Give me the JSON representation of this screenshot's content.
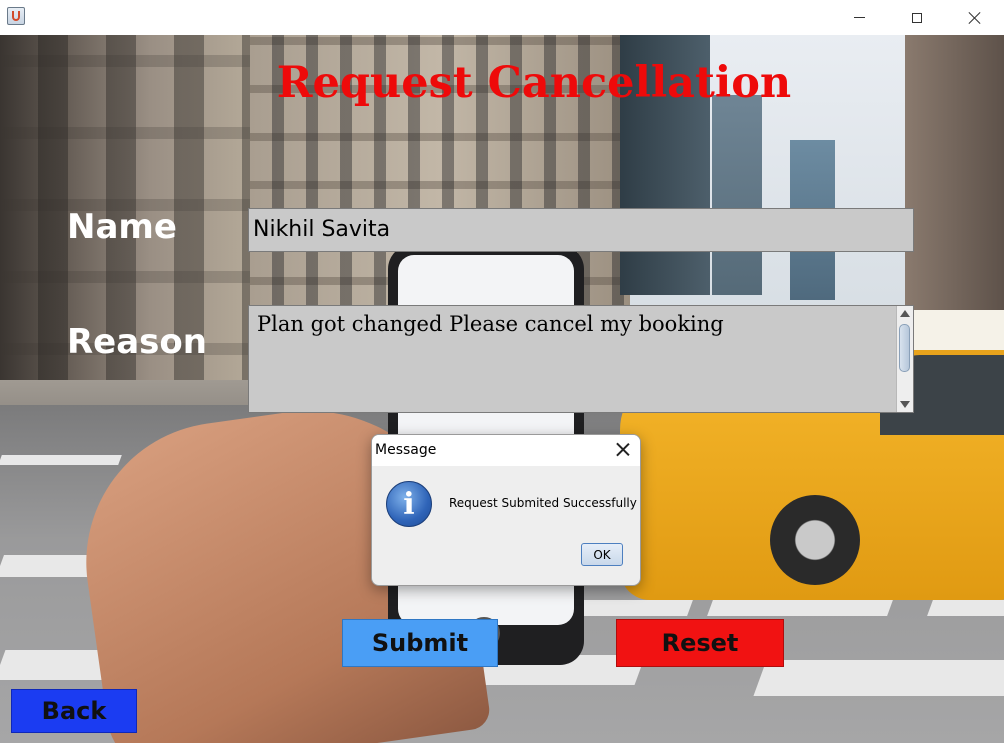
{
  "window": {
    "controls": {
      "minimize_icon": "minimize-icon",
      "maximize_icon": "maximize-icon",
      "close_icon": "close-icon"
    }
  },
  "form": {
    "title": "Request Cancellation",
    "name_label": "Name",
    "name_value": "Nikhil Savita",
    "reason_label": "Reason",
    "reason_value": "Plan got changed Please cancel my booking"
  },
  "buttons": {
    "submit": "Submit",
    "reset": "Reset",
    "back": "Back"
  },
  "dialog": {
    "title": "Message",
    "icon": "info-icon",
    "icon_glyph": "i",
    "message": "Request Submited Successfully",
    "ok": "OK"
  },
  "colors": {
    "title": "#ee0a0a",
    "submit": "#4a9ef5",
    "reset": "#f11212",
    "back": "#1b3cf2",
    "input_bg": "#c9c9c9"
  }
}
